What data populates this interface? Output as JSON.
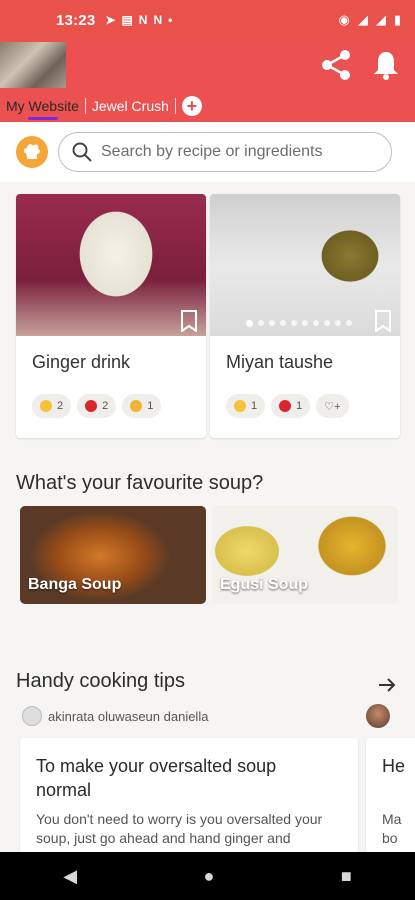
{
  "status": {
    "time": "13:23",
    "notif_icons": [
      "telegram-icon",
      "news-icon",
      "n-icon",
      "n-icon",
      "dot-icon"
    ],
    "n_glyph": "N",
    "right_icons": [
      "eye-icon",
      "signal-icon",
      "signal-icon",
      "battery-icon"
    ]
  },
  "header": {
    "tabs": [
      "My Website",
      "Jewel Crush"
    ],
    "add_tab_label": "+",
    "icons": [
      "share-icon",
      "bell-icon"
    ]
  },
  "search": {
    "placeholder": "Search by recipe or ingredients"
  },
  "recipes": [
    {
      "title": "Ginger drink",
      "reactions": [
        {
          "icon": "yum-icon",
          "count": "2"
        },
        {
          "icon": "heart-icon",
          "count": "2"
        },
        {
          "icon": "clap-icon",
          "count": "1"
        }
      ]
    },
    {
      "title": "Miyan taushe",
      "reactions": [
        {
          "icon": "yum-icon",
          "count": "1"
        },
        {
          "icon": "heart-icon",
          "count": "1"
        }
      ],
      "carousel_pages": 10,
      "carousel_current": 1
    }
  ],
  "soup_section": {
    "title": "What's your favourite soup?",
    "items": [
      "Banga Soup",
      "Egusi Soup"
    ]
  },
  "tips_section": {
    "title": "Handy cooking tips",
    "author": "akinrata oluwaseun daniella",
    "tip": {
      "title": "To make your oversalted soup normal",
      "desc": "You don't need to worry is you oversalted your soup, just go ahead and hand ginger and"
    },
    "next_tip": {
      "title": "He",
      "desc": "Ma bo mo"
    }
  },
  "colors": {
    "brand": "#ea5150",
    "tab_indicator": "#7e2bd4",
    "chef_badge": "#f4a638"
  }
}
